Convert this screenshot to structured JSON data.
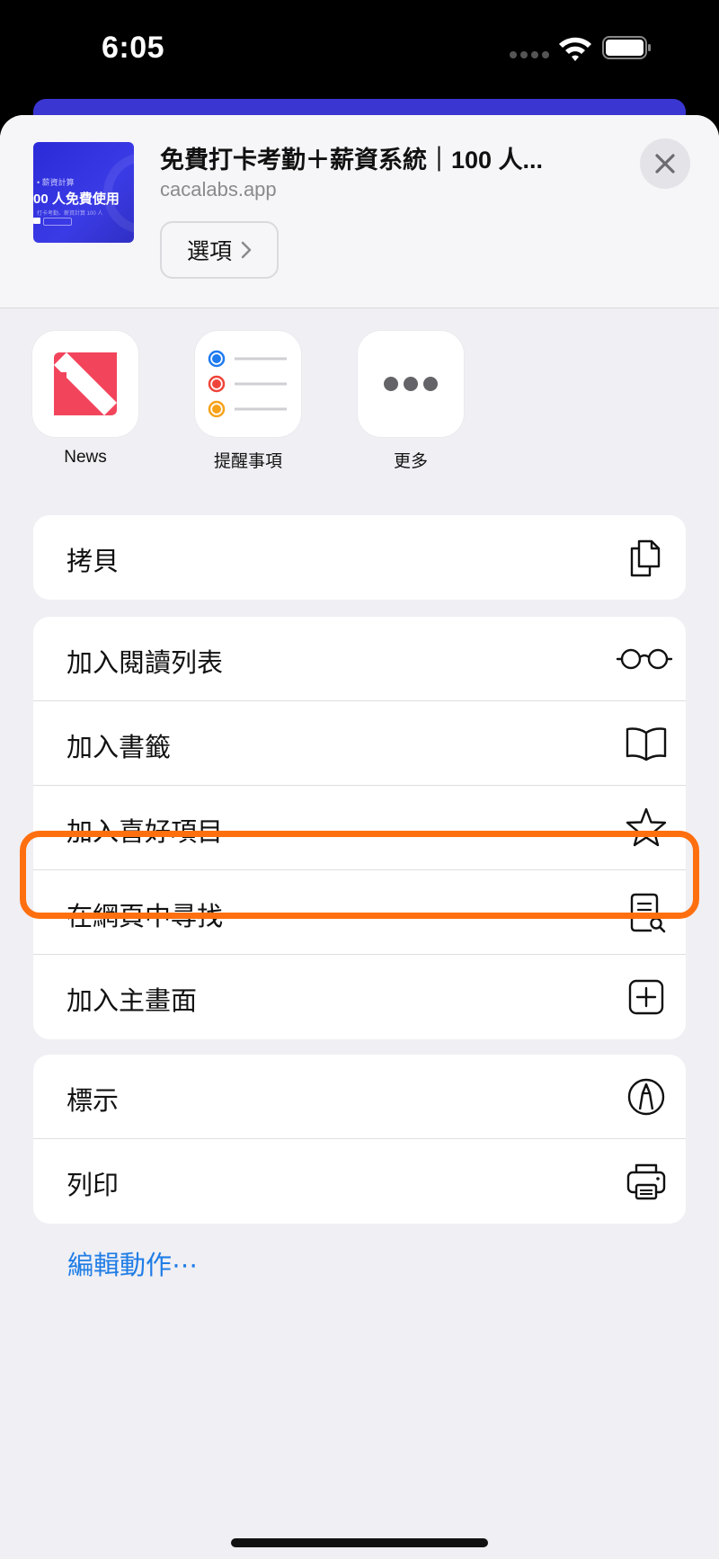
{
  "status_bar": {
    "time": "6:05"
  },
  "share_header": {
    "title": "免費打卡考勤＋薪資系統｜100 人...",
    "url": "cacalabs.app",
    "options_label": "選項",
    "thumbnail": {
      "line1": "• 薪資計算",
      "line2": "00 人免費使用",
      "line3": "打卡考勤、薪資計算 100 人"
    }
  },
  "apps": [
    {
      "label": "News",
      "icon": "news-icon"
    },
    {
      "label": "提醒事項",
      "icon": "reminders-icon"
    },
    {
      "label": "更多",
      "icon": "more-icon"
    }
  ],
  "actions": {
    "copy": "拷貝",
    "reading_list": "加入閱讀列表",
    "bookmark": "加入書籤",
    "favorites": "加入喜好項目",
    "find": "在網頁中尋找",
    "home_screen": "加入主畫面",
    "markup": "標示",
    "print": "列印"
  },
  "edit_actions": "編輯動作⋯",
  "colors": {
    "accent": "#1f7de6",
    "highlight": "#ff6f0f",
    "news_red": "#f2455c"
  }
}
